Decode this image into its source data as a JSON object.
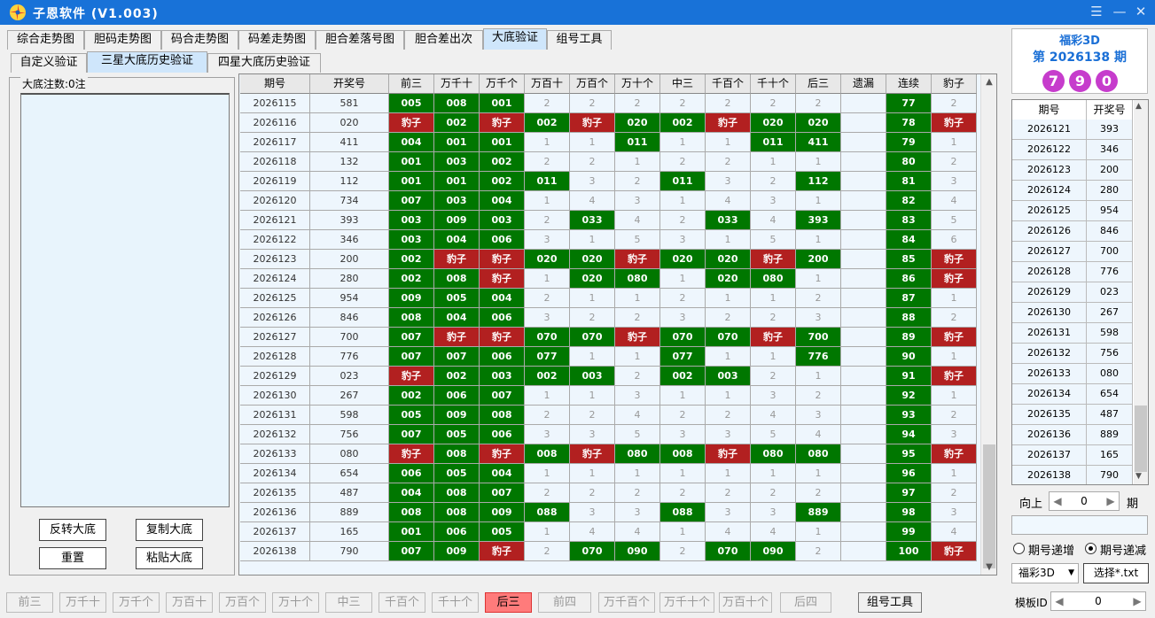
{
  "window": {
    "title": "子恩软件 (V1.003)",
    "min_glyph": "☰",
    "dash_glyph": "—",
    "close_glyph": "✕"
  },
  "tabs_main": [
    "综合走势图",
    "胆码走势图",
    "码合走势图",
    "码差走势图",
    "胆合差落号图",
    "胆合差出次",
    "大底验证",
    "组号工具"
  ],
  "tabs_sub": [
    "自定义验证",
    "三星大底历史验证",
    "四星大底历史验证"
  ],
  "left_panel": {
    "label": "大底注数:0注",
    "buttons": [
      "反转大底",
      "复制大底",
      "重置",
      "粘贴大底"
    ]
  },
  "grid": {
    "headers": [
      "期号",
      "开奖号",
      "前三",
      "万千十",
      "万千个",
      "万百十",
      "万百个",
      "万十个",
      "中三",
      "千百个",
      "千十个",
      "后三",
      "遗漏",
      "连续",
      "豹子"
    ],
    "rows": [
      [
        "2026115",
        "581",
        "005:g",
        "008:g",
        "001:g",
        "2:d",
        "2:d",
        "2:d",
        "2:d",
        "2:d",
        "2:d",
        "2:d",
        ":n",
        "77:g",
        "2:d"
      ],
      [
        "2026116",
        "020",
        "豹子:r",
        "002:g",
        "豹子:r",
        "002:g",
        "豹子:r",
        "020:g",
        "002:g",
        "豹子:r",
        "020:g",
        "020:g",
        ":n",
        "78:g",
        "豹子:r"
      ],
      [
        "2026117",
        "411",
        "004:g",
        "001:g",
        "001:g",
        "1:d",
        "1:d",
        "011:g",
        "1:d",
        "1:d",
        "011:g",
        "411:g",
        ":n",
        "79:g",
        "1:d"
      ],
      [
        "2026118",
        "132",
        "001:g",
        "003:g",
        "002:g",
        "2:d",
        "2:d",
        "1:d",
        "2:d",
        "2:d",
        "1:d",
        "1:d",
        ":n",
        "80:g",
        "2:d"
      ],
      [
        "2026119",
        "112",
        "001:g",
        "001:g",
        "002:g",
        "011:g",
        "3:d",
        "2:d",
        "011:g",
        "3:d",
        "2:d",
        "112:g",
        ":n",
        "81:g",
        "3:d"
      ],
      [
        "2026120",
        "734",
        "007:g",
        "003:g",
        "004:g",
        "1:d",
        "4:d",
        "3:d",
        "1:d",
        "4:d",
        "3:d",
        "1:d",
        ":n",
        "82:g",
        "4:d"
      ],
      [
        "2026121",
        "393",
        "003:g",
        "009:g",
        "003:g",
        "2:d",
        "033:g",
        "4:d",
        "2:d",
        "033:g",
        "4:d",
        "393:g",
        ":n",
        "83:g",
        "5:d"
      ],
      [
        "2026122",
        "346",
        "003:g",
        "004:g",
        "006:g",
        "3:d",
        "1:d",
        "5:d",
        "3:d",
        "1:d",
        "5:d",
        "1:d",
        ":n",
        "84:g",
        "6:d"
      ],
      [
        "2026123",
        "200",
        "002:g",
        "豹子:r",
        "豹子:r",
        "020:g",
        "020:g",
        "豹子:r",
        "020:g",
        "020:g",
        "豹子:r",
        "200:g",
        ":n",
        "85:g",
        "豹子:r"
      ],
      [
        "2026124",
        "280",
        "002:g",
        "008:g",
        "豹子:r",
        "1:d",
        "020:g",
        "080:g",
        "1:d",
        "020:g",
        "080:g",
        "1:d",
        ":n",
        "86:g",
        "豹子:r"
      ],
      [
        "2026125",
        "954",
        "009:g",
        "005:g",
        "004:g",
        "2:d",
        "1:d",
        "1:d",
        "2:d",
        "1:d",
        "1:d",
        "2:d",
        ":n",
        "87:g",
        "1:d"
      ],
      [
        "2026126",
        "846",
        "008:g",
        "004:g",
        "006:g",
        "3:d",
        "2:d",
        "2:d",
        "3:d",
        "2:d",
        "2:d",
        "3:d",
        ":n",
        "88:g",
        "2:d"
      ],
      [
        "2026127",
        "700",
        "007:g",
        "豹子:r",
        "豹子:r",
        "070:g",
        "070:g",
        "豹子:r",
        "070:g",
        "070:g",
        "豹子:r",
        "700:g",
        ":n",
        "89:g",
        "豹子:r"
      ],
      [
        "2026128",
        "776",
        "007:g",
        "007:g",
        "006:g",
        "077:g",
        "1:d",
        "1:d",
        "077:g",
        "1:d",
        "1:d",
        "776:g",
        ":n",
        "90:g",
        "1:d"
      ],
      [
        "2026129",
        "023",
        "豹子:r",
        "002:g",
        "003:g",
        "002:g",
        "003:g",
        "2:d",
        "002:g",
        "003:g",
        "2:d",
        "1:d",
        ":n",
        "91:g",
        "豹子:r"
      ],
      [
        "2026130",
        "267",
        "002:g",
        "006:g",
        "007:g",
        "1:d",
        "1:d",
        "3:d",
        "1:d",
        "1:d",
        "3:d",
        "2:d",
        ":n",
        "92:g",
        "1:d"
      ],
      [
        "2026131",
        "598",
        "005:g",
        "009:g",
        "008:g",
        "2:d",
        "2:d",
        "4:d",
        "2:d",
        "2:d",
        "4:d",
        "3:d",
        ":n",
        "93:g",
        "2:d"
      ],
      [
        "2026132",
        "756",
        "007:g",
        "005:g",
        "006:g",
        "3:d",
        "3:d",
        "5:d",
        "3:d",
        "3:d",
        "5:d",
        "4:d",
        ":n",
        "94:g",
        "3:d"
      ],
      [
        "2026133",
        "080",
        "豹子:r",
        "008:g",
        "豹子:r",
        "008:g",
        "豹子:r",
        "080:g",
        "008:g",
        "豹子:r",
        "080:g",
        "080:g",
        ":n",
        "95:g",
        "豹子:r"
      ],
      [
        "2026134",
        "654",
        "006:g",
        "005:g",
        "004:g",
        "1:d",
        "1:d",
        "1:d",
        "1:d",
        "1:d",
        "1:d",
        "1:d",
        ":n",
        "96:g",
        "1:d"
      ],
      [
        "2026135",
        "487",
        "004:g",
        "008:g",
        "007:g",
        "2:d",
        "2:d",
        "2:d",
        "2:d",
        "2:d",
        "2:d",
        "2:d",
        ":n",
        "97:g",
        "2:d"
      ],
      [
        "2026136",
        "889",
        "008:g",
        "008:g",
        "009:g",
        "088:g",
        "3:d",
        "3:d",
        "088:g",
        "3:d",
        "3:d",
        "889:g",
        ":n",
        "98:g",
        "3:d"
      ],
      [
        "2026137",
        "165",
        "001:g",
        "006:g",
        "005:g",
        "1:d",
        "4:d",
        "4:d",
        "1:d",
        "4:d",
        "4:d",
        "1:d",
        ":n",
        "99:g",
        "4:d"
      ],
      [
        "2026138",
        "790",
        "007:g",
        "009:g",
        "豹子:r",
        "2:d",
        "070:g",
        "090:g",
        "2:d",
        "070:g",
        "090:g",
        "2:d",
        ":n",
        "100:g",
        "豹子:r"
      ]
    ]
  },
  "lottery": {
    "name": "福彩3D",
    "issue": "第 2026138 期",
    "balls": [
      "7",
      "9",
      "0"
    ]
  },
  "mini_table": {
    "headers": [
      "期号",
      "开奖号"
    ],
    "rows": [
      [
        "2026121",
        "393"
      ],
      [
        "2026122",
        "346"
      ],
      [
        "2026123",
        "200"
      ],
      [
        "2026124",
        "280"
      ],
      [
        "2026125",
        "954"
      ],
      [
        "2026126",
        "846"
      ],
      [
        "2026127",
        "700"
      ],
      [
        "2026128",
        "776"
      ],
      [
        "2026129",
        "023"
      ],
      [
        "2026130",
        "267"
      ],
      [
        "2026131",
        "598"
      ],
      [
        "2026132",
        "756"
      ],
      [
        "2026133",
        "080"
      ],
      [
        "2026134",
        "654"
      ],
      [
        "2026135",
        "487"
      ],
      [
        "2026136",
        "889"
      ],
      [
        "2026137",
        "165"
      ],
      [
        "2026138",
        "790"
      ]
    ]
  },
  "right_controls": {
    "up_label": "向上",
    "up_value": "0",
    "period_label": "期",
    "radio_asc": "期号递增",
    "radio_desc": "期号递减",
    "radio_selected": "desc",
    "lottery_select": "福彩3D",
    "choose_txt": "选择*.txt",
    "template_label": "模板ID",
    "template_value": "0"
  },
  "bottom_buttons": [
    "前三",
    "万千十",
    "万千个",
    "万百十",
    "万百个",
    "万十个",
    "中三",
    "千百个",
    "千十个",
    "后三",
    "前四",
    "万千百个",
    "万千十个",
    "万百十个",
    "后四",
    "组号工具"
  ],
  "bottom_active": "后三",
  "colors": {
    "titlebar": "#1872d8",
    "green": "#007700",
    "red": "#b22020",
    "ball": "#c63ccc",
    "active_tab": "#cfe6fb",
    "grid_bg": "#eef6fd"
  }
}
